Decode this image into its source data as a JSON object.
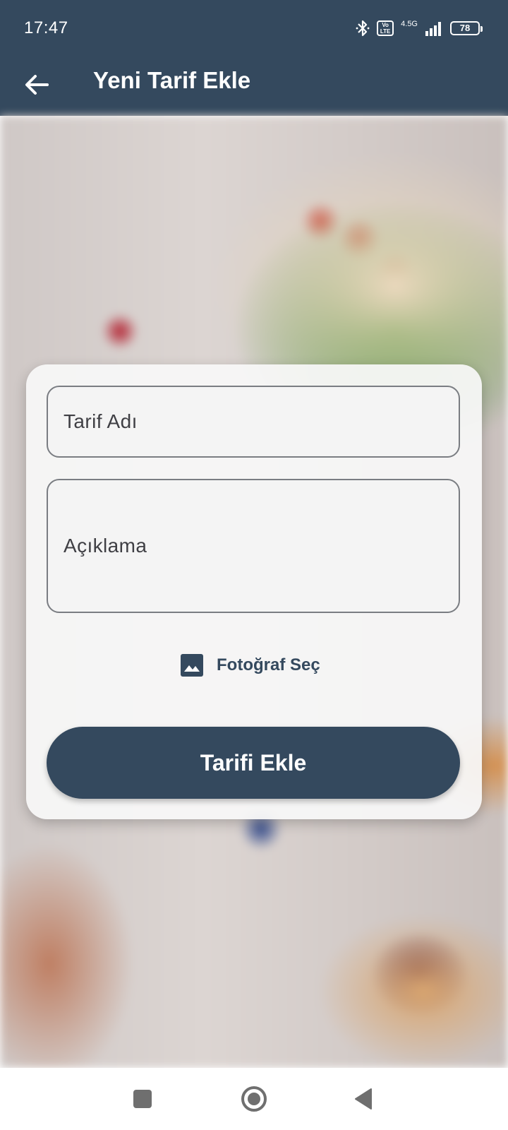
{
  "status_bar": {
    "time": "17:47",
    "volte": "Vo LTE",
    "network": "4.5G",
    "battery": "78"
  },
  "app_bar": {
    "title": "Yeni Tarif Ekle",
    "back_icon": "arrow-left-icon"
  },
  "form": {
    "recipe_name_placeholder": "Tarif Adı",
    "description_placeholder": "Açıklama",
    "photo_label": "Fotoğraf Seç",
    "photo_icon": "image-icon",
    "submit_label": "Tarifi Ekle"
  },
  "nav_bar": {
    "items": [
      "square-recents-icon",
      "circle-home-icon",
      "triangle-back-icon"
    ]
  },
  "colors": {
    "primary": "#34495e",
    "card": "#f7f7f7",
    "on_primary": "#ffffff"
  }
}
